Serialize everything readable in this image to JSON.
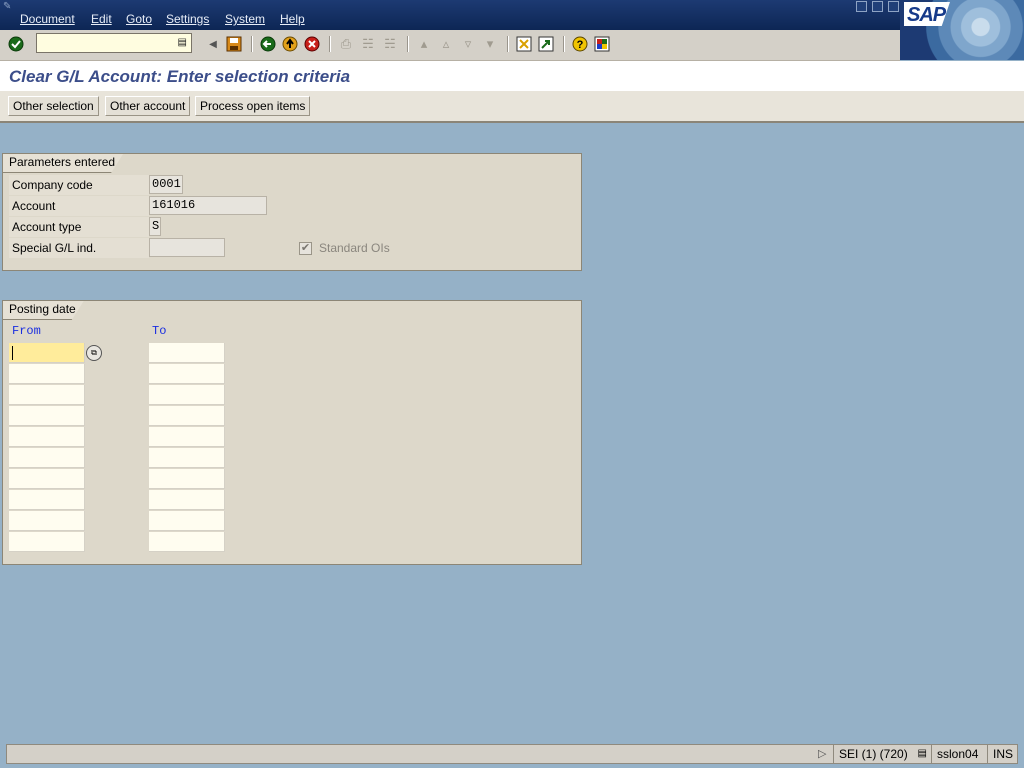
{
  "menubar": {
    "items": [
      "Document",
      "Edit",
      "Goto",
      "Settings",
      "System",
      "Help"
    ]
  },
  "brand": {
    "logo_text": "SAP"
  },
  "toolbar": {
    "command_value": ""
  },
  "title": "Clear G/L Account: Enter selection criteria",
  "app_toolbar": {
    "buttons": [
      "Other selection",
      "Other account",
      "Process open items"
    ]
  },
  "parameters": {
    "title": "Parameters entered",
    "company_code_label": "Company code",
    "company_code_value": "0001",
    "account_label": "Account",
    "account_value": "161016",
    "account_type_label": "Account type",
    "account_type_value": "S",
    "special_gl_label": "Special G/L ind.",
    "special_gl_value": "",
    "standard_ois_label": "Standard OIs",
    "standard_ois_checked": true
  },
  "posting_date": {
    "title": "Posting date",
    "from_label": "From",
    "to_label": "To",
    "rows": 10
  },
  "statusbar": {
    "session": "SEI (1) (720)",
    "server": "sslon04",
    "mode": "INS"
  },
  "colors": {
    "background": "#95b1c7",
    "menubar": "#0d2655",
    "title_text": "#3c4e8a",
    "group_bg": "#ddd8ca",
    "column_header": "#1a2ee0",
    "active_input": "#ffec9b"
  }
}
